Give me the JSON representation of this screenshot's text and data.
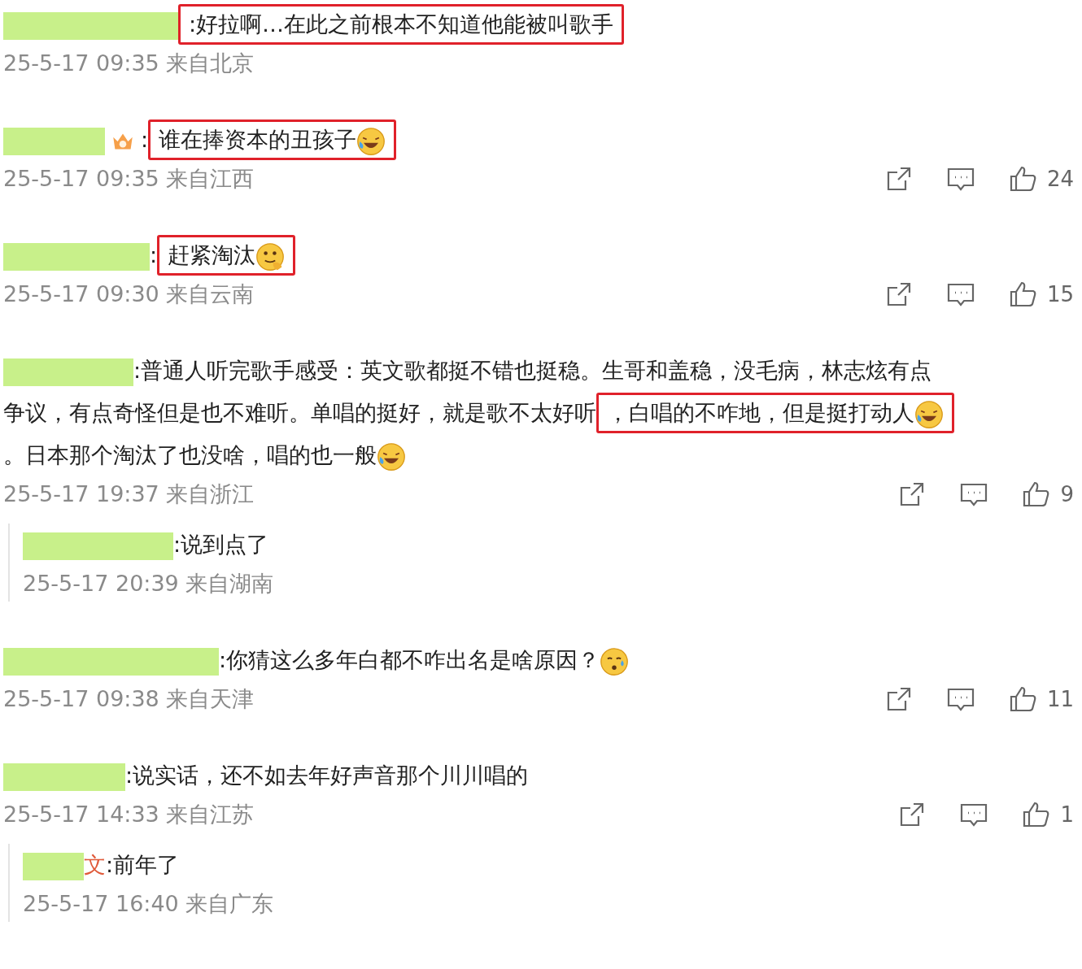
{
  "comments": [
    {
      "parts": [
        {
          "kind": "box",
          "text": ":好拉啊…在此之前根本不知道他能被叫歌手"
        }
      ],
      "time": "25-5-17 09:35 来自北京"
    },
    {
      "badge": true,
      "parts": [
        {
          "kind": "text",
          "text": ":"
        },
        {
          "kind": "box",
          "text": "谁在捧资本的丑孩子",
          "emoji": {
            "kind": "laugh"
          }
        }
      ],
      "time": "25-5-17 09:35 来自江西",
      "likes": "24"
    },
    {
      "parts": [
        {
          "kind": "text",
          "text": ":"
        },
        {
          "kind": "box",
          "text": "赶紧淘汰",
          "emoji": {
            "kind": "think"
          }
        }
      ],
      "time": "25-5-17 09:30 来自云南",
      "likes": "15"
    },
    {
      "parts": [
        {
          "kind": "text",
          "text": ":普通人听完歌手感受：英文歌都挺不错也挺稳。生哥和盖稳，没毛病，林志炫有点"
        },
        {
          "kind": "text",
          "text": "争议，有点奇怪但是也不难听。单唱的挺好，就是歌不太好听"
        },
        {
          "kind": "box",
          "text": "，白唱的不咋地，但是挺打动人",
          "emoji": {
            "kind": "laugh"
          }
        },
        {
          "kind": "text",
          "text": "。日本那个淘汰了也没啥，唱的也一般",
          "emoji": {
            "kind": "laugh"
          }
        }
      ],
      "time": "25-5-17 19:37 来自浙江",
      "likes": "9",
      "replies": [
        {
          "parts": [
            {
              "kind": "text",
              "text": ":说到点了"
            }
          ],
          "time": "25-5-17 20:39 来自湖南"
        }
      ]
    },
    {
      "parts": [
        {
          "kind": "text",
          "text": ":你猜这么多年白都不咋出名是啥原因？",
          "emoji": {
            "kind": "sweat"
          }
        }
      ],
      "time": "25-5-17 09:38 来自天津",
      "likes": "11"
    },
    {
      "parts": [
        {
          "kind": "text",
          "text": ":说实话，还不如去年好声音那个川川唱的"
        }
      ],
      "time": "25-5-17 14:33 来自江苏",
      "likes": "1",
      "replies": [
        {
          "name_tail": "文",
          "parts": [
            {
              "kind": "text",
              "text": ":前年了"
            }
          ],
          "time": "25-5-17 16:40 来自广东"
        }
      ]
    }
  ]
}
